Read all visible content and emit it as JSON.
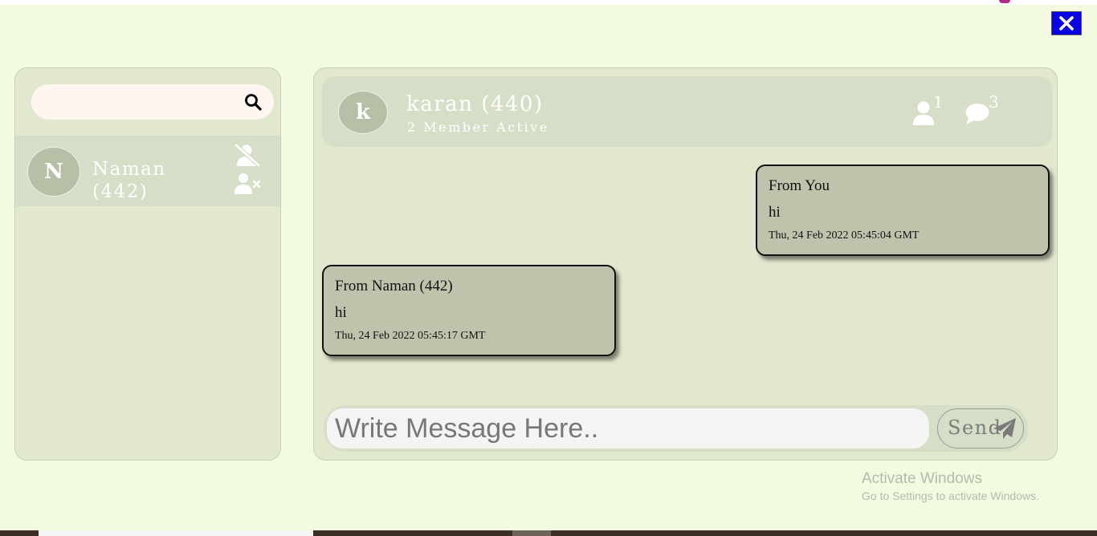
{
  "colors": {
    "page_background": "#f2fadf",
    "panel_background": "#e2e8ce",
    "header_background": "#d7dec7",
    "bubble_background": "#bfc3ac",
    "close_button": "#0a00e6"
  },
  "window": {
    "close_icon": "close-icon"
  },
  "sidebar": {
    "search": {
      "value": "",
      "placeholder": "",
      "icon": "search-icon"
    },
    "contacts": [
      {
        "initial": "N",
        "name": "Naman",
        "id_label": "(442)",
        "actions": [
          "user-slash-icon",
          "user-remove-icon"
        ]
      }
    ]
  },
  "chat": {
    "header": {
      "initial": "k",
      "title": "karan (440)",
      "subtitle": "2 Member Active",
      "members_count": "1",
      "messages_count": "3",
      "members_icon": "user-icon",
      "messages_icon": "comment-icon"
    },
    "messages": [
      {
        "direction": "outgoing",
        "from": "From You",
        "text": "hi",
        "time": "Thu, 24 Feb 2022 05:45:04 GMT"
      },
      {
        "direction": "incoming",
        "from": "From Naman (442)",
        "text": "hi",
        "time": "Thu, 24 Feb 2022 05:45:17 GMT"
      }
    ],
    "composer": {
      "value": "",
      "placeholder": "Write Message Here..",
      "send_label": "Send",
      "send_icon": "paper-plane-icon"
    }
  },
  "watermark": {
    "line1": "Activate Windows",
    "line2": "Go to Settings to activate Windows."
  }
}
